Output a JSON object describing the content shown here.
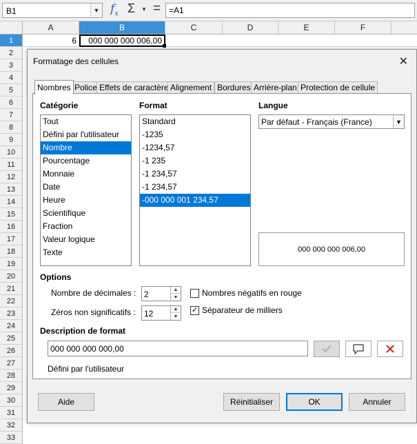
{
  "formula_bar": {
    "name_box": "B1",
    "formula": "=A1",
    "fx_glyph": "f",
    "fx_sub": "x",
    "sum_glyph": "Σ",
    "equals_glyph": "="
  },
  "sheet": {
    "columns": [
      "A",
      "B",
      "C",
      "D",
      "E",
      "F"
    ],
    "active_column": "B",
    "rows": [
      "1",
      "2",
      "3",
      "4",
      "5",
      "6",
      "7",
      "8",
      "9",
      "10",
      "11",
      "12",
      "13",
      "14",
      "15",
      "16",
      "17",
      "18",
      "19",
      "20",
      "21",
      "22",
      "23",
      "24",
      "25",
      "26",
      "27",
      "28",
      "29",
      "30",
      "31",
      "32",
      "33"
    ],
    "active_row": "1",
    "cell_a1": "6",
    "cell_b1": "000 000 000 006,00"
  },
  "dialog": {
    "title": "Formatage des cellules",
    "close_glyph": "✕",
    "tabs": [
      "Nombres",
      "Police",
      "Effets de caractère",
      "Alignement",
      "Bordures",
      "Arrière-plan",
      "Protection de cellule"
    ],
    "active_tab": "Nombres",
    "category": {
      "label": "Catégorie",
      "items": [
        "Tout",
        "Défini par l'utilisateur",
        "Nombre",
        "Pourcentage",
        "Monnaie",
        "Date",
        "Heure",
        "Scientifique",
        "Fraction",
        "Valeur logique",
        "Texte"
      ],
      "selected": "Nombre"
    },
    "format": {
      "label": "Format",
      "items": [
        "Standard",
        "-1235",
        "-1234,57",
        "-1 235",
        "-1 234,57",
        "-1 234,57",
        "-000 000 001 234,57"
      ],
      "selected_index": 6
    },
    "language": {
      "label": "Langue",
      "value": "Par défaut - Français (France)"
    },
    "preview": "000 000 000 006,00",
    "options": {
      "label": "Options",
      "decimals_label": "Nombre de décimales :",
      "decimals_value": "2",
      "leading_zeros_label": "Zéros non significatifs :",
      "leading_zeros_value": "12",
      "negative_red_label": "Nombres négatifs en rouge",
      "negative_red_checked": false,
      "thousands_sep_label": "Séparateur de milliers",
      "thousands_sep_checked": true
    },
    "format_code": {
      "label": "Description de format",
      "value": "000 000 000 000,00",
      "user_defined_note": "Défini par l'utilisateur"
    },
    "buttons": {
      "help": "Aide",
      "reset": "Réinitialiser",
      "ok": "OK",
      "cancel": "Annuler"
    }
  },
  "colors": {
    "selection": "#0078d7",
    "active_header": "#3d8fd6",
    "delete_icon": "#d42020"
  }
}
